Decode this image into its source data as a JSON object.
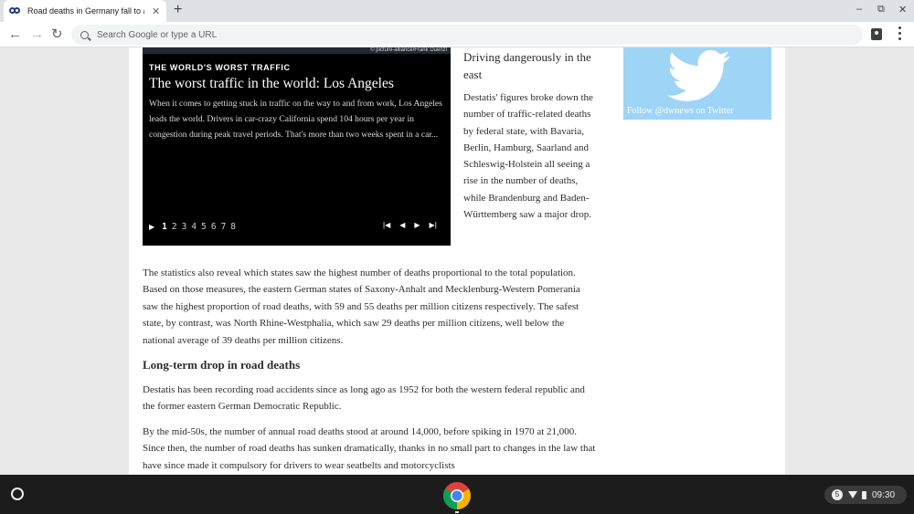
{
  "browser": {
    "tab": {
      "title": "Road deaths in Germany fall to a",
      "close": "✕"
    },
    "new_tab": "+",
    "window_controls": {
      "minimize": "‒",
      "restore": "⧉",
      "close": "✕"
    },
    "nav": {
      "back": "←",
      "forward": "→",
      "reload": "↻"
    },
    "omnibox": {
      "placeholder": "Search Google or type a URL"
    }
  },
  "gallery": {
    "photo_credit": "© picture-alliance/Frank Duenzl",
    "kicker": "THE WORLD'S WORST TRAFFIC",
    "headline": "The worst traffic in the world: Los Angeles",
    "text": "When it comes to getting stuck in traffic on the way to and from work, Los Angeles leads the world. Drivers in car-crazy California spend 104 hours per year in congestion during peak travel periods. That's more than two weeks spent in a car...",
    "play": "▶",
    "pages": [
      "1",
      "2",
      "3",
      "4",
      "5",
      "6",
      "7",
      "8"
    ],
    "active_page": "1",
    "controls": {
      "first": "|◀",
      "prev": "◀",
      "next": "▶",
      "last": "▶|"
    }
  },
  "sidebar": {
    "subheading": "Driving dangerously in the east",
    "paragraph": "Destatis' figures broke down the number of traffic-related deaths by federal state, with Bavaria, Berlin, Hamburg, Saarland and Schleswig-Holstein all seeing a rise in the number of deaths, while Brandenburg and Baden-Württemberg saw a major drop."
  },
  "twitter": {
    "label": "Follow @dwnews on Twitter",
    "color": "#9ed4f6"
  },
  "article": {
    "para1": "The statistics also reveal which states saw the highest number of deaths proportional to the total population. Based on those measures, the eastern German states of Saxony-Anhalt and Mecklenburg-Western Pomerania saw the highest proportion of road deaths, with 59 and 55 deaths per million citizens respectively. The safest state, by contrast, was North Rhine-Westphalia, which saw 29 deaths per million citizens, well below the national average of 39 deaths per million citizens.",
    "heading": "Long-term drop in road deaths",
    "para2": "Destatis has been recording road accidents since as long ago as 1952 for both the western federal republic and the former eastern German Democratic Republic.",
    "para3": "By the mid-50s, the number of annual road deaths stood at around 14,000, before spiking in 1970 at 21,000. Since then, the number of road deaths has sunken dramatically, thanks in no small part to changes in the law that have since made it compulsory for drivers to wear seatbelts and motorcyclists"
  },
  "shelf": {
    "notifications": "5",
    "time": "09:30"
  }
}
